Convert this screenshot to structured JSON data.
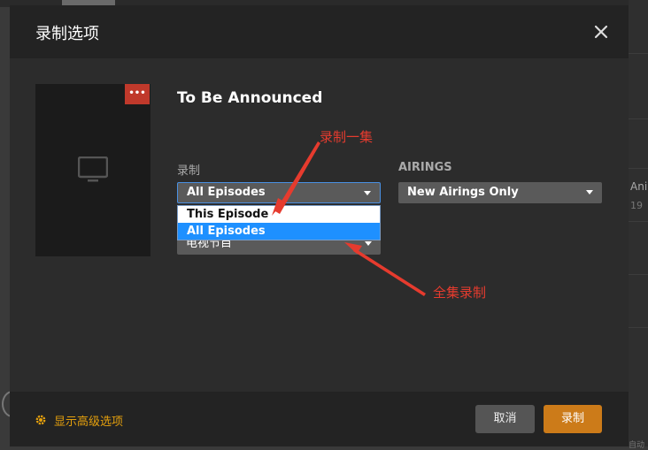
{
  "background": {
    "right_text_1": "Ani",
    "right_text_2": "19",
    "right_text_3": "自动"
  },
  "dialog": {
    "title": "录制选项",
    "close_label": "✕"
  },
  "poster": {
    "badge": "•••",
    "icon": "tv-icon"
  },
  "show": {
    "title": "To Be Announced"
  },
  "fields": {
    "record_label": "录制",
    "record_value": "All Episodes",
    "record_options": [
      "This Episode",
      "All Episodes"
    ],
    "record_highlighted": "All Episodes",
    "airings_label": "AIRINGS",
    "airings_value": "New Airings Only",
    "library_value": "电视节目"
  },
  "annotations": {
    "one_episode": "录制一集",
    "all_episodes": "全集录制",
    "color": "#e63b2e"
  },
  "footer": {
    "advanced_label": "显示高级选项",
    "cancel_label": "取消",
    "record_label": "录制"
  },
  "colors": {
    "accent": "#cc7b19",
    "advanced_text": "#e5a00d",
    "badge": "#c0392b",
    "selection": "#1e90ff"
  }
}
